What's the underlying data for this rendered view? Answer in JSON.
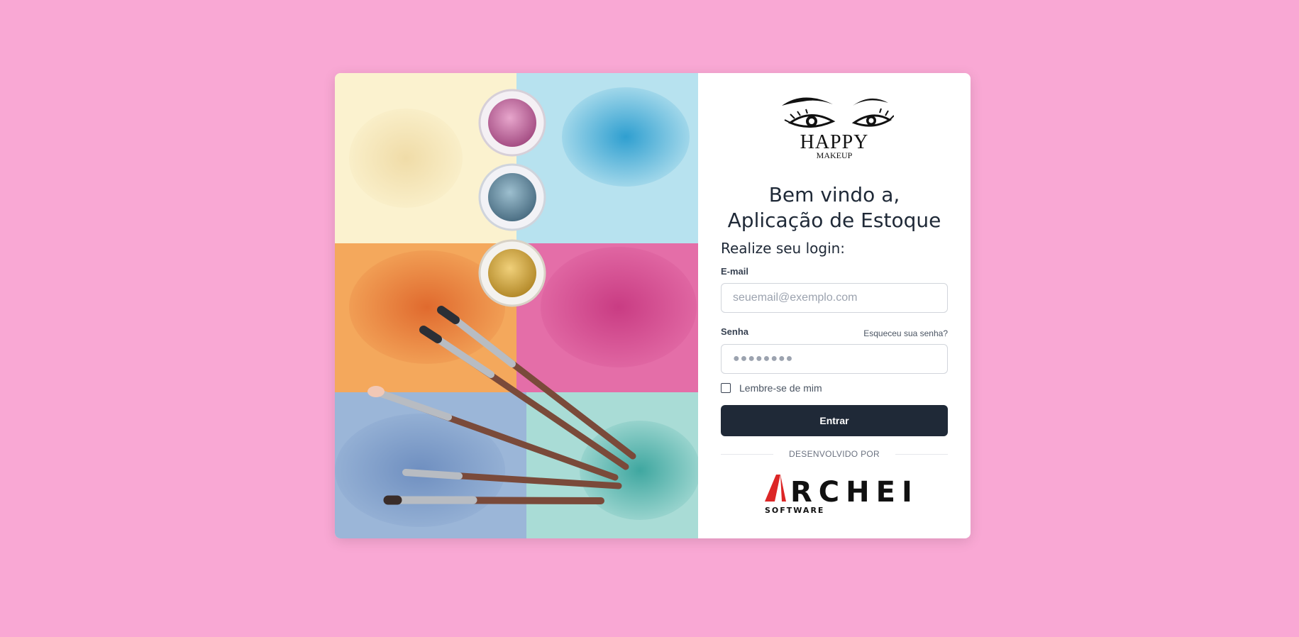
{
  "brand": {
    "logo_icon": "eyes-logo",
    "name": "HAPPY",
    "tagline": "MAKEUP"
  },
  "welcome": {
    "line1": "Bem vindo a,",
    "line2": "Aplicação de Estoque"
  },
  "login": {
    "subtitle": "Realize seu login:",
    "email_label": "E-mail",
    "email_placeholder": "seuemail@exemplo.com",
    "password_label": "Senha",
    "password_value": "●●●●●●●●",
    "forgot_label": "Esqueceu sua senha?",
    "remember_label": "Lembre-se de mim",
    "remember_checked": false,
    "submit_label": "Entrar"
  },
  "footer": {
    "developed_by": "DESENVOLVIDO POR",
    "company_name": "RCHEI",
    "company_sub": "SOFTWARE"
  },
  "colors": {
    "page_bg": "#f9a8d4",
    "button_bg": "#1f2937",
    "accent_red": "#dc2626"
  }
}
